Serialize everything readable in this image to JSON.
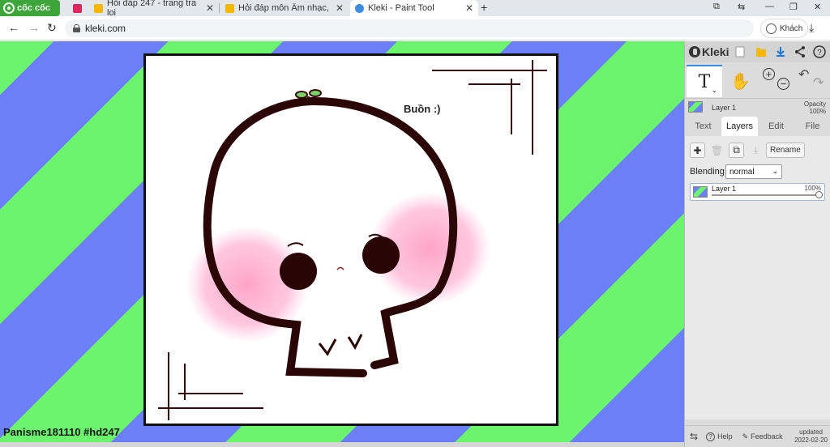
{
  "browser": {
    "brand_label": "cốc cốc",
    "tabs": [
      {
        "label": "Hỏi đáp 247 - trang tra loi",
        "favicon_color": "#f5b800"
      },
      {
        "label": "Hỏi đáp môn Âm nhạc, Mỹ t",
        "favicon_color": "#f5b800"
      },
      {
        "label": "Kleki - Paint Tool",
        "favicon_color": "#3c8de0",
        "active": true
      }
    ],
    "pinned_tab_color": "#e0245e",
    "url": "kleki.com",
    "profile_label": "Khách"
  },
  "canvas": {
    "caption": "Buồn :)",
    "signature": "Panisme181110 #hd247",
    "stripe_colors": [
      "#6a7ff8",
      "#6cf46f"
    ]
  },
  "panel": {
    "logo_label": "Kleki",
    "active_tool": "T",
    "current_layer": {
      "name": "Layer 1",
      "opacity_label": "Opacity",
      "opacity_value": "100%"
    },
    "tabs": [
      "Text",
      "Layers",
      "Edit",
      "File"
    ],
    "active_tab": "Layers",
    "layer_buttons": {
      "rename_label": "Rename"
    },
    "blending": {
      "label": "Blending",
      "value": "normal"
    },
    "layers": [
      {
        "name": "Layer 1",
        "opacity": "100%"
      }
    ],
    "footer": {
      "help_label": "Help",
      "feedback_label": "Feedback",
      "updated_label": "updated",
      "updated_date": "2022-02-20"
    }
  }
}
